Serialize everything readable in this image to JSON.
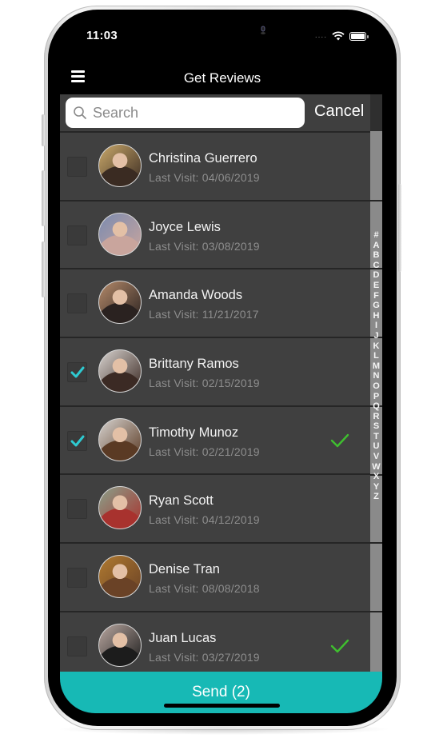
{
  "status_bar": {
    "time": "11:03"
  },
  "header": {
    "title": "Get Reviews"
  },
  "search": {
    "placeholder": "Search",
    "value": "",
    "cancel_label": "Cancel"
  },
  "colors": {
    "accent": "#17b9b5",
    "check": "#2ecad1",
    "review_check": "#3fbf2f",
    "panel": "#404040"
  },
  "contacts": [
    {
      "name": "Christina Guerrero",
      "last_visit": "Last Visit: 04/06/2019",
      "selected": false,
      "reviewed": false,
      "avatar_colors": [
        "#c9a86a",
        "#3a2b22"
      ]
    },
    {
      "name": "Joyce Lewis",
      "last_visit": "Last Visit: 03/08/2019",
      "selected": false,
      "reviewed": false,
      "avatar_colors": [
        "#7b8bb0",
        "#c9a59d"
      ]
    },
    {
      "name": "Amanda Woods",
      "last_visit": "Last Visit: 11/21/2017",
      "selected": false,
      "reviewed": false,
      "avatar_colors": [
        "#b48a6a",
        "#2a2220"
      ]
    },
    {
      "name": "Brittany Ramos",
      "last_visit": "Last Visit: 02/15/2019",
      "selected": true,
      "reviewed": false,
      "avatar_colors": [
        "#d8d3cf",
        "#3b2a24"
      ]
    },
    {
      "name": "Timothy Munoz",
      "last_visit": "Last Visit: 02/21/2019",
      "selected": true,
      "reviewed": true,
      "avatar_colors": [
        "#d6d2ce",
        "#5a3a24"
      ]
    },
    {
      "name": "Ryan Scott",
      "last_visit": "Last Visit: 04/12/2019",
      "selected": false,
      "reviewed": false,
      "avatar_colors": [
        "#8aa08a",
        "#a8322e"
      ]
    },
    {
      "name": "Denise Tran",
      "last_visit": "Last Visit: 08/08/2018",
      "selected": false,
      "reviewed": false,
      "avatar_colors": [
        "#b07a30",
        "#6a4226"
      ]
    },
    {
      "name": "Juan Lucas",
      "last_visit": "Last Visit: 03/27/2019",
      "selected": false,
      "reviewed": true,
      "avatar_colors": [
        "#b9a7a0",
        "#1c1c1c"
      ]
    }
  ],
  "index_letters": [
    "#",
    "A",
    "B",
    "C",
    "D",
    "E",
    "F",
    "G",
    "H",
    "I",
    "J",
    "K",
    "L",
    "M",
    "N",
    "O",
    "P",
    "Q",
    "R",
    "S",
    "T",
    "U",
    "V",
    "W",
    "X",
    "Y",
    "Z"
  ],
  "send_button": {
    "label": "Send (2)"
  }
}
